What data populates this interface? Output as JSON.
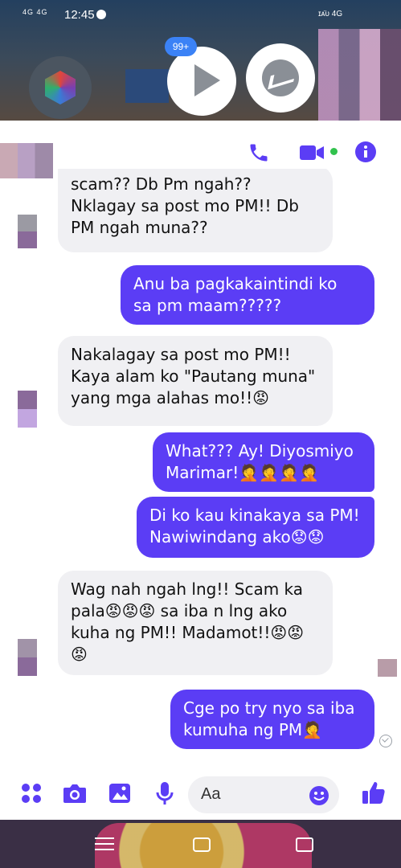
{
  "statusbar": {
    "network_left": "4G 4G",
    "time": "12:45",
    "network_right": "ɪᴀ̈ᴜ 4G"
  },
  "floating": {
    "badge": "99+"
  },
  "messages": [
    {
      "dir": "in",
      "text": "scam?? Db Pm ngah??\nNklagay sa post mo PM!! Db\nPM ngah muna??"
    },
    {
      "dir": "out",
      "text": "Anu ba pagkakaintindi ko\nsa pm maam?????"
    },
    {
      "dir": "in",
      "text": "Nakalagay sa post mo PM!!\nKaya alam ko \"Pautang muna\"\nyang mga alahas mo!!😡"
    },
    {
      "dir": "out",
      "text": "What??? Ay! Diyosmiyo\nMarimar!🤦🤦🤦🤦"
    },
    {
      "dir": "out",
      "text": "Di ko kau kinakaya sa PM!\nNawiwindang ako😟😟"
    },
    {
      "dir": "in",
      "text": "Wag nah ngah lng!! Scam ka\npala😡😡😡 sa iba n lng ako\nkuha ng PM!! Madamot!!😡😡\n😡"
    },
    {
      "dir": "out",
      "text": "Cge po try nyo sa iba\nkumuha ng PM🤦"
    }
  ],
  "composer": {
    "placeholder": "Aa"
  },
  "icons": {
    "top": [
      "phone-icon",
      "video-call-icon",
      "info-icon"
    ],
    "composer": [
      "apps-icon",
      "camera-icon",
      "gallery-icon",
      "microphone-icon",
      "emoji-icon",
      "like-icon"
    ]
  },
  "colors": {
    "accent": "#5b3df5",
    "incoming_bg": "#f0f0f3",
    "online": "#31c24d"
  }
}
